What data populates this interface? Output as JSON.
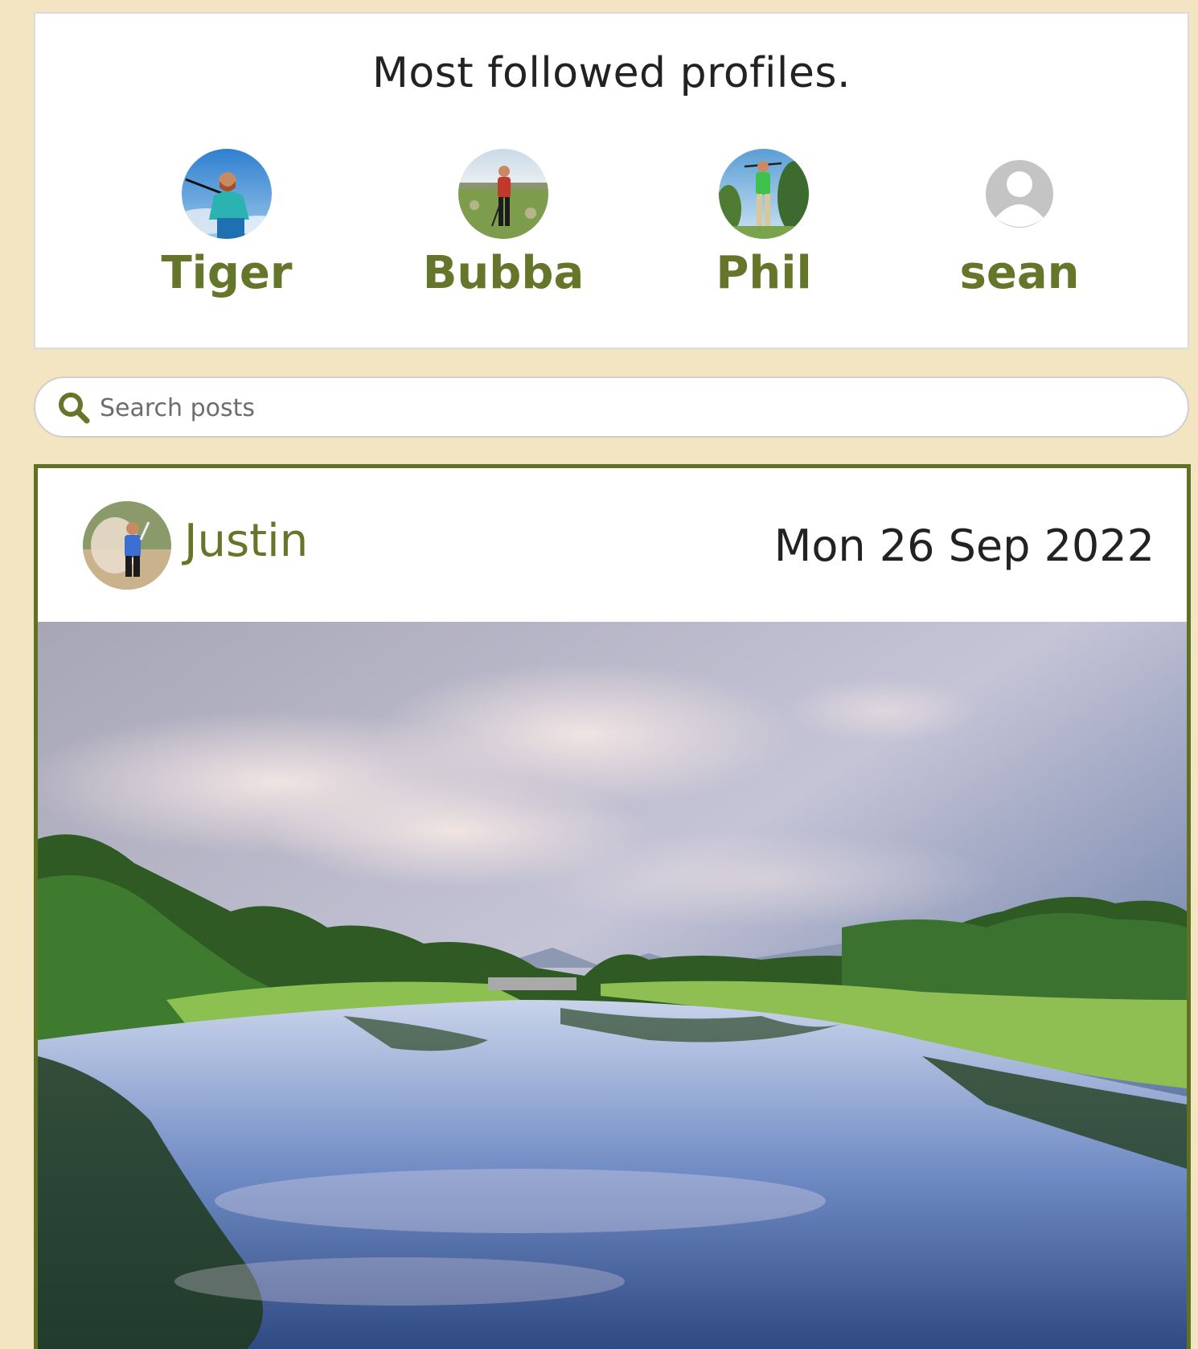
{
  "profiles_section": {
    "title": "Most followed profiles.",
    "profiles": [
      {
        "name": "Tiger",
        "avatar": "golfer-photo"
      },
      {
        "name": "Bubba",
        "avatar": "golfer-photo"
      },
      {
        "name": "Phil",
        "avatar": "golfer-photo"
      },
      {
        "name": "sean",
        "avatar": "default-user-icon"
      }
    ]
  },
  "search": {
    "placeholder": "Search posts",
    "value": "",
    "icon": "search-icon"
  },
  "post": {
    "author": "Justin",
    "date": "Mon 26 Sep 2022",
    "image": "golf-course-lake-photo"
  },
  "colors": {
    "page_background": "#f4e5c2",
    "accent_green": "#65762a",
    "post_border": "#617124",
    "card_background": "#ffffff"
  }
}
